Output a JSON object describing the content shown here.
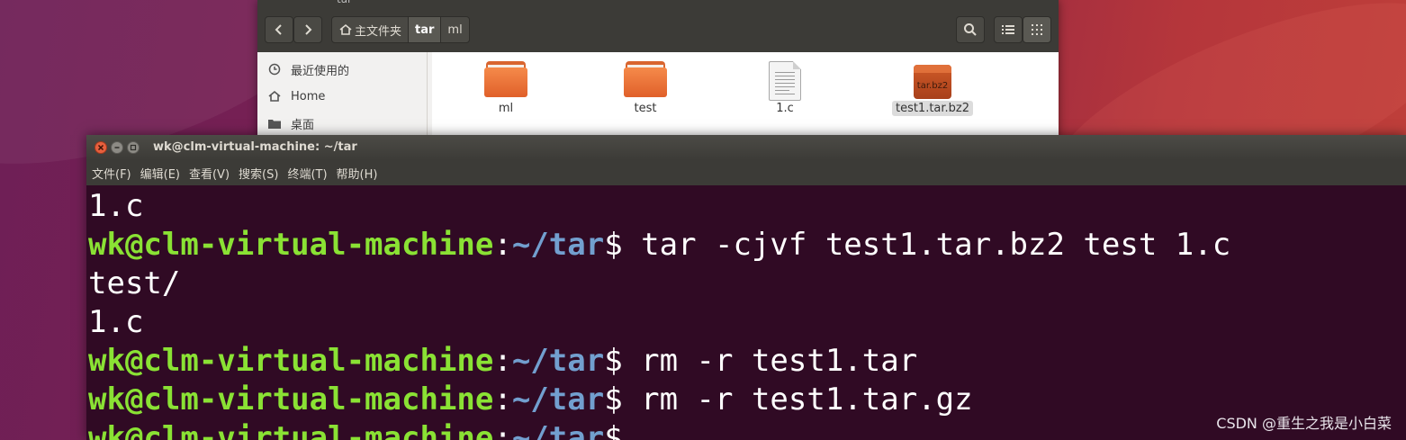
{
  "file_manager": {
    "title": "tar",
    "breadcrumbs": [
      {
        "label": "主文件夹",
        "icon": "home-icon"
      },
      {
        "label": "tar"
      },
      {
        "label": "ml"
      }
    ],
    "sidebar": [
      {
        "label": "最近使用的",
        "icon": "clock-icon"
      },
      {
        "label": "Home",
        "icon": "home-icon"
      },
      {
        "label": "桌面",
        "icon": "desktop-folder-icon"
      }
    ],
    "files": [
      {
        "name": "ml",
        "type": "folder"
      },
      {
        "name": "test",
        "type": "folder"
      },
      {
        "name": "1.c",
        "type": "text"
      },
      {
        "name": "test1.tar.bz2",
        "type": "archive",
        "icon_text": "tar.bz2",
        "selected": true
      }
    ]
  },
  "terminal": {
    "title": "wk@clm-virtual-machine: ~/tar",
    "menu": [
      "文件(F)",
      "编辑(E)",
      "查看(V)",
      "搜索(S)",
      "终端(T)",
      "帮助(H)"
    ],
    "prompt": {
      "user": "wk@clm-virtual-machine",
      "sep": ":",
      "path": "~/tar",
      "dollar": "$"
    },
    "lines": [
      {
        "kind": "output",
        "text": "1.c"
      },
      {
        "kind": "prompt",
        "cmd": " tar -cjvf test1.tar.bz2 test 1.c"
      },
      {
        "kind": "output",
        "text": "test/"
      },
      {
        "kind": "output",
        "text": "1.c"
      },
      {
        "kind": "prompt",
        "cmd": " rm -r test1.tar"
      },
      {
        "kind": "prompt",
        "cmd": " rm -r test1.tar.gz"
      },
      {
        "kind": "prompt",
        "cmd": ""
      }
    ],
    "colors": {
      "background": "#300a24",
      "user": "#8ae234",
      "path": "#729fcf",
      "text": "#ffffff"
    }
  },
  "watermark": "CSDN @重生之我是小白菜"
}
